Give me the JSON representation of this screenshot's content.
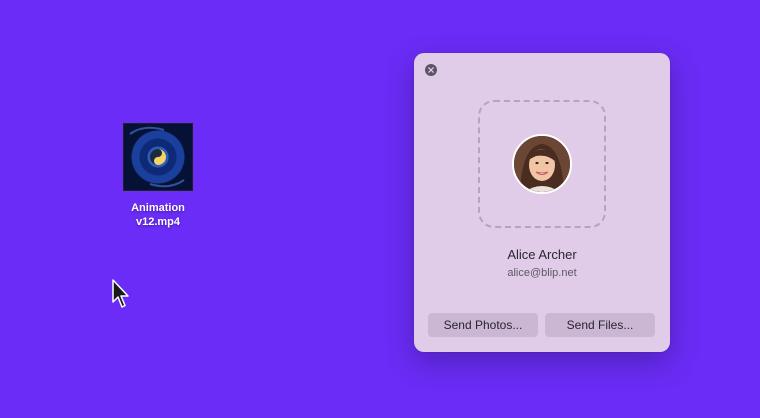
{
  "desktop": {
    "file": {
      "name": "Animation\nv12.mp4",
      "icon": "video-thumbnail"
    }
  },
  "panel": {
    "close_icon": "close-icon",
    "contact": {
      "name": "Alice Archer",
      "email": "alice@blip.net"
    },
    "buttons": {
      "send_photos": "Send Photos...",
      "send_files": "Send Files..."
    }
  },
  "colors": {
    "desktop_background": "#6a2cf6",
    "panel_background": "#e0cbe8",
    "button_background": "#cbb6d3"
  }
}
